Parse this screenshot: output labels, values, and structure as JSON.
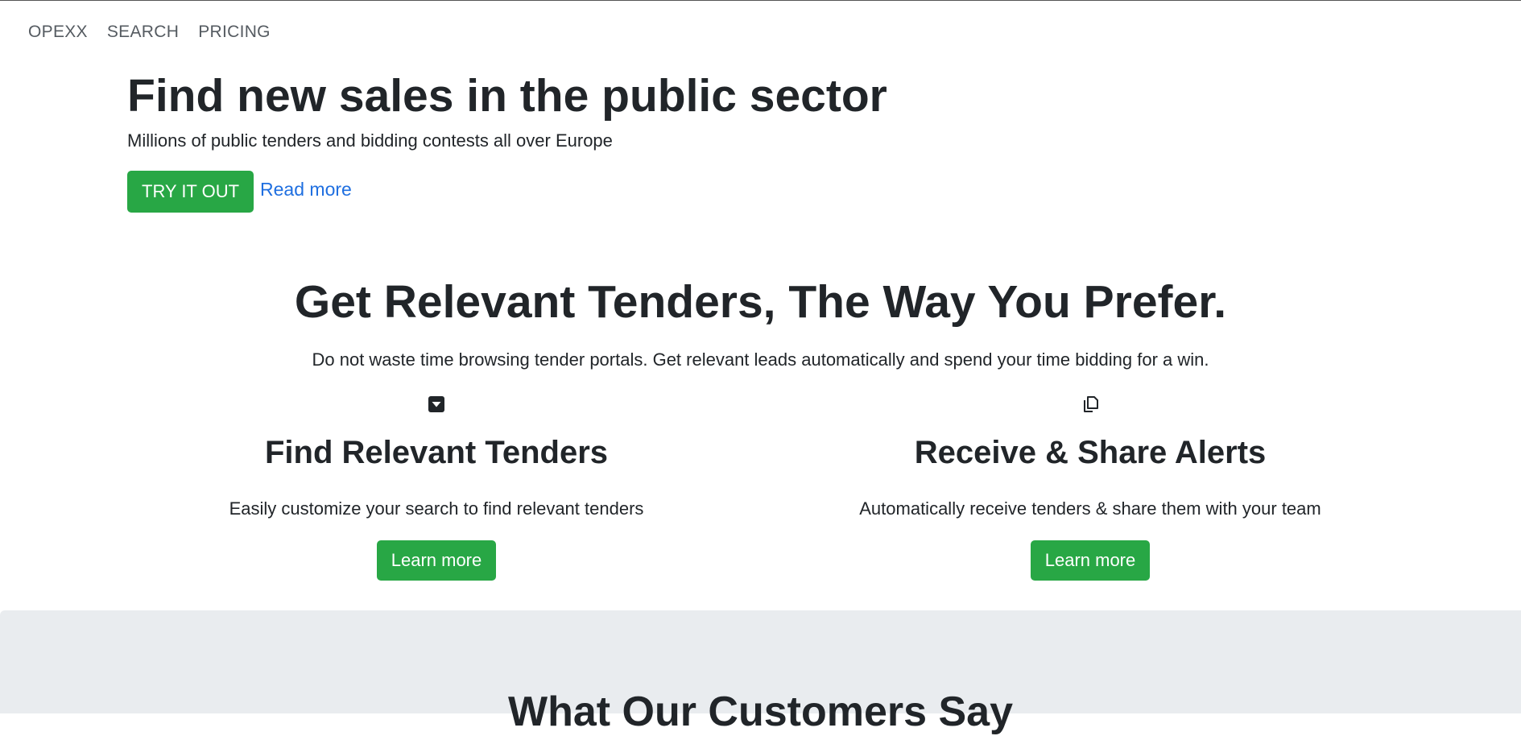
{
  "nav": {
    "items": [
      "OPEXX",
      "SEARCH",
      "PRICING"
    ]
  },
  "hero": {
    "title": "Find new sales in the public sector",
    "subtitle": "Millions of public tenders and bidding contests all over Europe",
    "try_label": "TRY IT OUT",
    "read_more_label": "Read more"
  },
  "features_section": {
    "title": "Get Relevant Tenders, The Way You Prefer.",
    "subtitle": "Do not waste time browsing tender portals. Get relevant leads automatically and spend your time bidding for a win.",
    "items": [
      {
        "icon": "caret-down-square-icon",
        "title": "Find Relevant Tenders",
        "description": "Easily customize your search to find relevant tenders",
        "button_label": "Learn more"
      },
      {
        "icon": "files-icon",
        "title": "Receive & Share Alerts",
        "description": "Automatically receive tenders & share them with your team",
        "button_label": "Learn more"
      }
    ]
  },
  "testimonials": {
    "title": "What Our Customers Say"
  },
  "colors": {
    "accent_green": "#28a745",
    "link_blue": "#1f6fe0",
    "section_bg": "#e9ecef",
    "text": "#212529"
  }
}
